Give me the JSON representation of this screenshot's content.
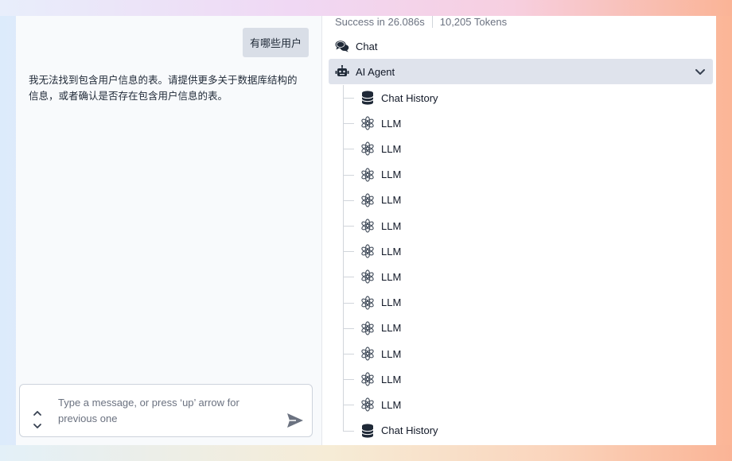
{
  "chat": {
    "user_message": "有哪些用户",
    "assistant_message": "我无法找到包含用户信息的表。请提供更多关于数据库结构的信息，或者确认是否存在包含用户信息的表。",
    "composer_placeholder": "Type a message, or press ‘up’ arrow for previous one"
  },
  "trace": {
    "status": "Success in 26.086s",
    "tokens": "10,205 Tokens",
    "root": {
      "label": "Chat",
      "icon": "chat-bubbles-icon"
    },
    "agent": {
      "label": "AI Agent",
      "icon": "robot-icon",
      "expanded": true
    },
    "children": [
      {
        "label": "Chat History",
        "icon": "database-icon"
      },
      {
        "label": "LLM",
        "icon": "openai-icon"
      },
      {
        "label": "LLM",
        "icon": "openai-icon"
      },
      {
        "label": "LLM",
        "icon": "openai-icon"
      },
      {
        "label": "LLM",
        "icon": "openai-icon"
      },
      {
        "label": "LLM",
        "icon": "openai-icon"
      },
      {
        "label": "LLM",
        "icon": "openai-icon"
      },
      {
        "label": "LLM",
        "icon": "openai-icon"
      },
      {
        "label": "LLM",
        "icon": "openai-icon"
      },
      {
        "label": "LLM",
        "icon": "openai-icon"
      },
      {
        "label": "LLM",
        "icon": "openai-icon"
      },
      {
        "label": "LLM",
        "icon": "openai-icon"
      },
      {
        "label": "LLM",
        "icon": "openai-icon"
      },
      {
        "label": "Chat History",
        "icon": "database-icon"
      }
    ]
  },
  "colors": {
    "selected_row": "#dfe3ec",
    "user_bubble": "#d9dee7",
    "muted_text": "#6b7280"
  }
}
